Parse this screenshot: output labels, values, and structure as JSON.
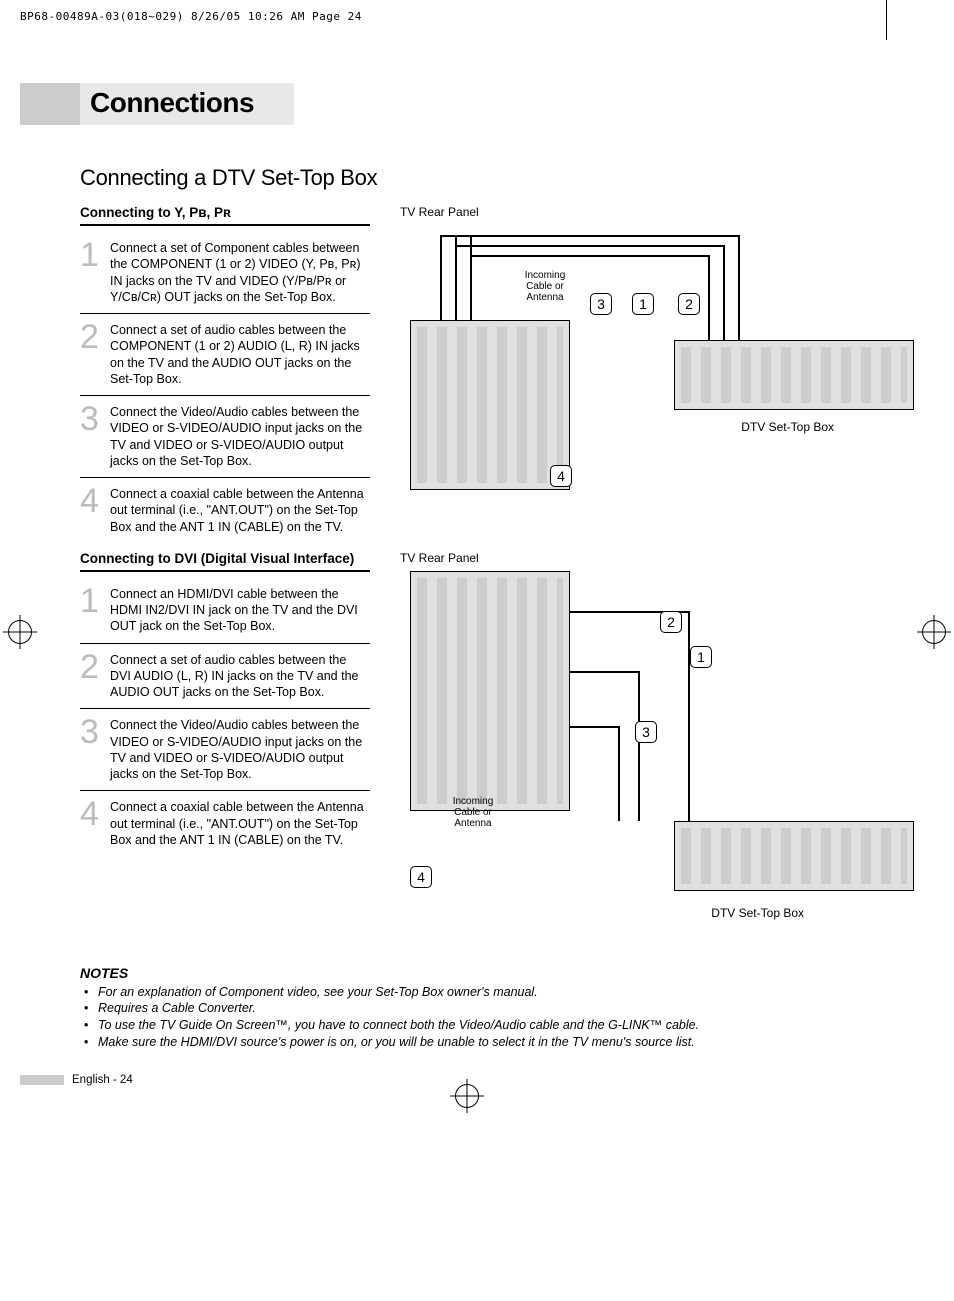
{
  "print_header": "BP68-00489A-03(018~029)  8/26/05  10:26 AM  Page 24",
  "section_title": "Connections",
  "page_title": "Connecting a DTV Set-Top Box",
  "sectionA": {
    "heading": "Connecting to Y, Pʙ, Pʀ",
    "steps": [
      "Connect a set of Component cables between the COMPONENT (1 or 2) VIDEO (Y, Pʙ, Pʀ) IN jacks on the TV and VIDEO (Y/Pʙ/Pʀ or Y/Cʙ/Cʀ) OUT jacks on the Set-Top Box.",
      "Connect a set of audio cables between the COMPONENT (1 or 2) AUDIO (L, R) IN jacks on the TV and the AUDIO OUT jacks on the Set-Top Box.",
      "Connect the Video/Audio cables between the VIDEO or S-VIDEO/AUDIO input jacks on the TV and VIDEO or S-VIDEO/AUDIO output jacks on the Set-Top Box.",
      "Connect a coaxial cable between the Antenna out terminal (i.e., \"ANT.OUT\") on the Set-Top Box and the ANT 1 IN (CABLE) on the TV."
    ]
  },
  "sectionB": {
    "heading": "Connecting to DVI (Digital Visual Interface)",
    "steps": [
      "Connect an HDMI/DVI cable between the HDMI IN2/DVI IN jack on the TV and the DVI OUT jack on the Set-Top Box.",
      "Connect a set of audio cables between the DVI AUDIO (L, R) IN jacks on the TV and the AUDIO OUT jacks on the Set-Top Box.",
      "Connect the Video/Audio cables between the VIDEO or S-VIDEO/AUDIO input jacks on the TV and VIDEO or S-VIDEO/AUDIO output jacks on the Set-Top Box.",
      "Connect a coaxial cable between the Antenna out terminal (i.e., \"ANT.OUT\") on the Set-Top Box and the ANT 1 IN (CABLE) on the TV."
    ]
  },
  "diagram1": {
    "panel_label": "TV Rear Panel",
    "incoming_label": "Incoming Cable or Antenna",
    "stb_label": "DTV Set-Top Box",
    "callouts": [
      "1",
      "2",
      "3",
      "4"
    ]
  },
  "diagram2": {
    "panel_label": "TV Rear Panel",
    "incoming_label": "Incoming Cable or Antenna",
    "stb_label": "DTV Set-Top Box",
    "callouts": [
      "1",
      "2",
      "3",
      "4"
    ]
  },
  "notes": {
    "heading": "NOTES",
    "items": [
      "For an explanation of Component video, see your Set-Top Box owner's manual.",
      "Requires a Cable Converter.",
      "To use the TV Guide On Screen™, you have to connect both the Video/Audio cable and the G-LINK™ cable.",
      "Make sure the HDMI/DVI source's power is on, or you will be unable to select it in the TV menu's source list."
    ]
  },
  "footer": "English - 24"
}
